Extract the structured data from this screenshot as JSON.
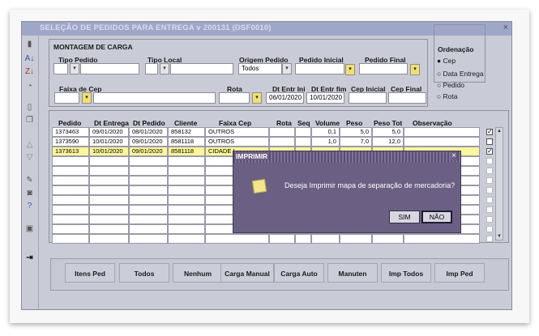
{
  "window": {
    "title": "SELEÇÃO DE PEDIDOS PARA ENTREGA v 200131 (DSF0010)",
    "close": "×"
  },
  "toolbar_icons": [
    "document-icon",
    "sort-az-icon",
    "sort-za-icon",
    "clock-icon",
    "page-icon",
    "copy-icon",
    "up-arrow-icon",
    "down-arrow-icon",
    "edit-icon",
    "camera-icon",
    "help-icon",
    "save-icon",
    "exit-icon"
  ],
  "panel": {
    "title": "MONTAGEM DE CARGA",
    "labels": {
      "tipo_pedido": "Tipo Pedido",
      "tipo_local": "Tipo Local",
      "origem_pedido": "Origem Pedido",
      "pedido_inicial": "Pedido Inicial",
      "pedido_final": "Pedido Final",
      "faixa_cep": "Faixa de Cep",
      "rota": "Rota",
      "dt_entr_ini": "Dt Entr Ini",
      "dt_entr_fim": "Dt Entr fim",
      "cep_inicial": "Cep Inicial",
      "cep_final": "Cep Final"
    },
    "values": {
      "origem_pedido": "Todos",
      "dt_entr_ini": "06/01/2020",
      "dt_entr_fim": "10/01/2020"
    }
  },
  "ordenacao": {
    "title": "Ordenação",
    "options": [
      "Cep",
      "Data Entrega",
      "Pedido",
      "Rota"
    ],
    "selected": "Cep"
  },
  "grid": {
    "headers": [
      "Pedido",
      "Dt Entrega",
      "Dt Pedido",
      "Cliente",
      "Faixa Cep",
      "Rota",
      "Seq",
      "Volume",
      "Peso",
      "Peso Tot",
      "Observação"
    ],
    "rows": [
      {
        "pedido": "1373463",
        "dt_entrega": "09/01/2020",
        "dt_pedido": "08/01/2020",
        "cliente": "858132",
        "faixa_cep": "OUTROS",
        "rota": "",
        "seq": "",
        "volume": "0,1",
        "peso": "5,0",
        "peso_tot": "5,0",
        "obs": "",
        "checked": true
      },
      {
        "pedido": "1373590",
        "dt_entrega": "10/01/2020",
        "dt_pedido": "09/01/2020",
        "cliente": "8581118",
        "faixa_cep": "OUTROS",
        "rota": "",
        "seq": "",
        "volume": "1,0",
        "peso": "7,0",
        "peso_tot": "12,0",
        "obs": "",
        "checked": false
      },
      {
        "pedido": "1373613",
        "dt_entrega": "10/01/2020",
        "dt_pedido": "09/01/2020",
        "cliente": "8581118",
        "faixa_cep": "CIDADE I",
        "rota": "",
        "seq": "",
        "volume": "",
        "peso": "",
        "peso_tot": "",
        "obs": "",
        "checked": true
      }
    ]
  },
  "buttons": [
    "Itens Ped",
    "Todos",
    "Nenhum",
    "Carga Manual",
    "Carga Auto",
    "Manuten",
    "Imp Todos",
    "Imp Ped"
  ],
  "dialog": {
    "title": "IMPRIMIR",
    "close": "×",
    "message": "Deseja Imprimir mapa de separação de mercadoria?",
    "yes": "SIM",
    "no": "NÃO"
  },
  "colors": {
    "window_bg": "#c9cbd6",
    "titlebar": "#9fa7c9",
    "highlight_row": "#fbf69a",
    "dialog_bg": "#6b5f83",
    "yellow_dropdown": "#f3e06a"
  }
}
